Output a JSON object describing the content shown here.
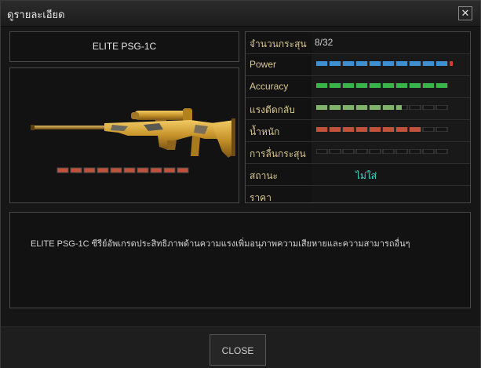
{
  "window": {
    "title": "ดูรายละเอียด",
    "close_icon": "close-icon"
  },
  "item": {
    "name": "ELITE PSG-1C",
    "level_segments": {
      "filled": 10,
      "total": 10,
      "color": "#c0523c"
    }
  },
  "stats": [
    {
      "label": "จำนวนกระสุน",
      "value": "8/32"
    },
    {
      "label": "Power",
      "filled": 10,
      "total": 10,
      "color": "#3e8fd1",
      "tip": "#d23a2a"
    },
    {
      "label": "Accuracy",
      "filled": 10,
      "total": 10,
      "color": "#38b44a"
    },
    {
      "label": "แรงดีดกลับ",
      "filled": 6.5,
      "total": 10,
      "color": "#7fb46a"
    },
    {
      "label": "น้ำหนัก",
      "filled": 8,
      "total": 10,
      "color": "#c0523c"
    },
    {
      "label": "การลื่นกระสุน",
      "filled": 0,
      "total": 10,
      "color": "#555555"
    },
    {
      "label": "สถานะ",
      "value": "ไม่ใส่"
    },
    {
      "label": "ราคา",
      "value": ""
    }
  ],
  "description": "ELITE PSG-1C ซีรีย์อัพเกรดประสิทธิภาพด้านความแรงเพิ่มอนุภาพความเสียหายและความสามารถอื่นๆ",
  "footer": {
    "close_label": "CLOSE"
  }
}
